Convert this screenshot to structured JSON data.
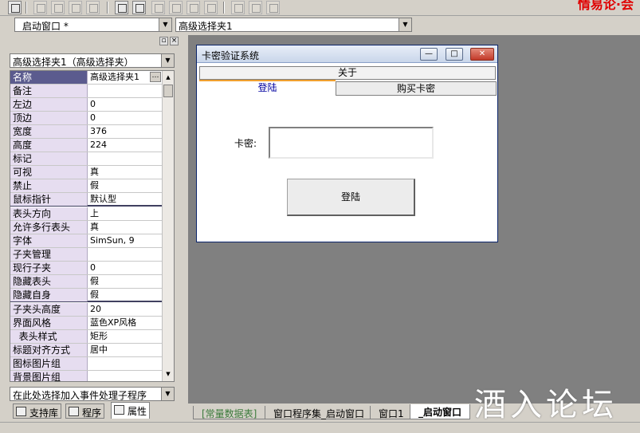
{
  "header": {
    "title_fragment": "情易论·会"
  },
  "combos": {
    "window_select": "_启动窗口 *",
    "control_select": "高级选择夹1"
  },
  "panel": {
    "object_select": "高级选择夹1（高级选择夹）",
    "properties": [
      {
        "name": "名称",
        "value": "高级选择夹1"
      },
      {
        "name": "备注",
        "value": ""
      },
      {
        "name": "左边",
        "value": "0"
      },
      {
        "name": "顶边",
        "value": "0"
      },
      {
        "name": "宽度",
        "value": "376"
      },
      {
        "name": "高度",
        "value": "224"
      },
      {
        "name": "标记",
        "value": ""
      },
      {
        "name": "可视",
        "value": "真"
      },
      {
        "name": "禁止",
        "value": "假"
      },
      {
        "name": "鼠标指针",
        "value": "默认型"
      },
      {
        "name": "表头方向",
        "value": "上"
      },
      {
        "name": "允许多行表头",
        "value": "真"
      },
      {
        "name": "字体",
        "value": "SimSun, 9"
      },
      {
        "name": "子夹管理",
        "value": ""
      },
      {
        "name": "现行子夹",
        "value": "0"
      },
      {
        "name": "隐藏表头",
        "value": "假"
      },
      {
        "name": "隐藏自身",
        "value": "假"
      },
      {
        "name": "子夹头高度",
        "value": "20"
      },
      {
        "name": "界面风格",
        "value": "蓝色XP风格"
      },
      {
        "name": "  表头样式",
        "value": "矩形"
      },
      {
        "name": "标题对齐方式",
        "value": "居中"
      },
      {
        "name": "图标图片组",
        "value": ""
      },
      {
        "name": "背景图片组",
        "value": ""
      }
    ],
    "event_select": "在此处选择加入事件处理子程序",
    "tabs": [
      "支持库",
      "程序",
      "属性"
    ]
  },
  "form": {
    "title": "卡密验证系统",
    "tab_about": "关于",
    "tab_login": "登陆",
    "tab_buy": "购买卡密",
    "card_label": "卡密:",
    "login_button": "登陆",
    "minimize": "—",
    "maximize": "□",
    "close": "✕"
  },
  "doc_tabs": [
    "[常量数据表]",
    "窗口程序集_启动窗口",
    "窗口1",
    "_启动窗口"
  ],
  "watermark": "酒入论坛"
}
